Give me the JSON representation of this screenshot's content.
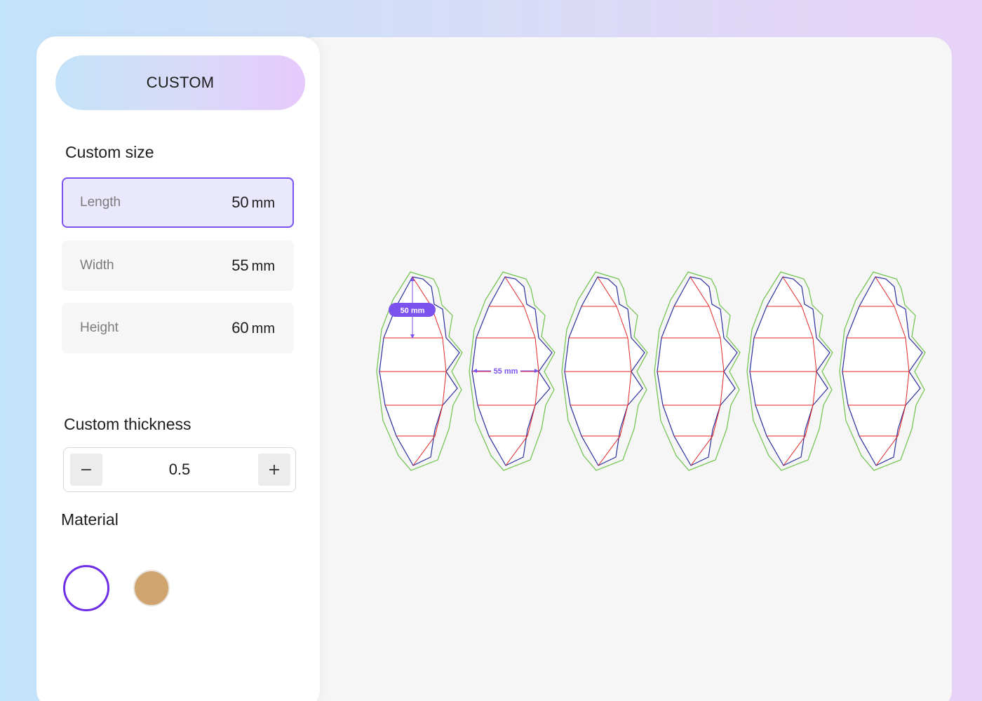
{
  "panel": {
    "mode_label": "CUSTOM",
    "size_title": "Custom size",
    "fields": [
      {
        "label": "Length",
        "value": "50",
        "unit": "mm"
      },
      {
        "label": "Width",
        "value": "55",
        "unit": "mm"
      },
      {
        "label": "Height",
        "value": "60",
        "unit": "mm"
      }
    ],
    "thickness_title": "Custom thickness",
    "thickness_value": "0.5",
    "minus_label": "−",
    "plus_label": "+",
    "material_title": "Material",
    "materials": [
      {
        "name": "white",
        "color": "#ffffff",
        "selected": true
      },
      {
        "name": "kraft",
        "color": "#cfa46f",
        "selected": false
      }
    ]
  },
  "preview": {
    "gore_count": 6,
    "length_annotation": "50 mm",
    "width_annotation": "55 mm",
    "colors": {
      "cut": "#6ec24a",
      "outline": "#2a2e9e",
      "fold": "#e02424",
      "dimension": "#7b52ee"
    }
  }
}
